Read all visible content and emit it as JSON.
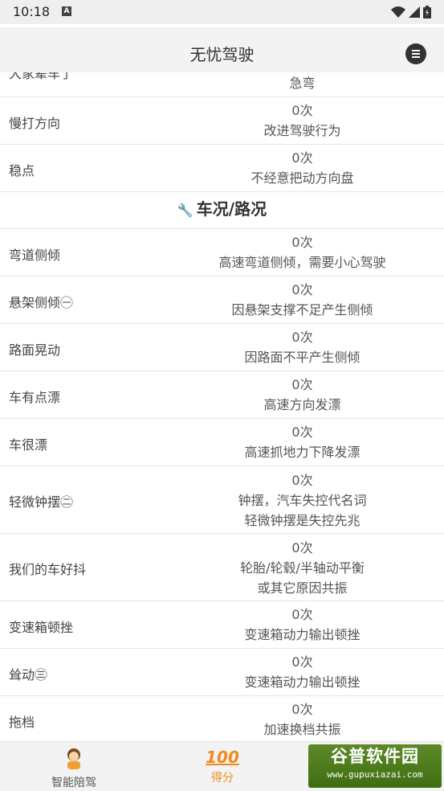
{
  "status_bar": {
    "time": "10:18",
    "a_icon": "A"
  },
  "app_bar": {
    "title": "无忧驾驶",
    "menu_icon": "menu-icon"
  },
  "top_partial_row": {
    "name": "大家辈车了",
    "line1": "急弯"
  },
  "rows_a": [
    {
      "name": "慢打方向",
      "lines": [
        "0次",
        "改进驾驶行为"
      ]
    },
    {
      "name": "稳点",
      "lines": [
        "0次",
        "不经意把动方向盘"
      ]
    }
  ],
  "section": {
    "icon": "wrench-icon",
    "title": "车况/路况"
  },
  "rows_b": [
    {
      "name": "弯道侧倾",
      "lines": [
        "0次",
        "高速弯道侧倾，需要小心驾驶"
      ]
    },
    {
      "name": "悬架侧倾㊀",
      "lines": [
        "0次",
        "因悬架支撑不足产生侧倾"
      ]
    },
    {
      "name": "路面晃动",
      "lines": [
        "0次",
        "因路面不平产生侧倾"
      ]
    },
    {
      "name": "车有点漂",
      "lines": [
        "0次",
        "高速方向发漂"
      ]
    },
    {
      "name": "车很漂",
      "lines": [
        "0次",
        "高速抓地力下降发漂"
      ]
    },
    {
      "name": "轻微钟摆㊁",
      "lines": [
        "0次",
        "钟摆，汽车失控代名词",
        "轻微钟摆是失控先兆"
      ]
    },
    {
      "name": "我们的车好抖",
      "lines": [
        "0次",
        "轮胎/轮毂/半轴动平衡",
        "或其它原因共振"
      ]
    },
    {
      "name": "变速箱顿挫",
      "lines": [
        "0次",
        "变速箱动力输出顿挫"
      ]
    },
    {
      "name": "耸动㊂",
      "lines": [
        "0次",
        "变速箱动力输出顿挫"
      ]
    },
    {
      "name": "拖档",
      "lines": [
        "0次",
        "加速换档共振"
      ]
    }
  ],
  "bottom_nav": {
    "items": [
      {
        "label": "智能陪驾",
        "icon": "driver-avatar-icon",
        "color": "#555555"
      },
      {
        "label": "得分",
        "icon": "score-100-icon",
        "color": "#f08a1c",
        "icon_text": "100"
      }
    ]
  },
  "watermark": {
    "big": "谷普软件园",
    "small": "www.gupuxiazai.com"
  }
}
